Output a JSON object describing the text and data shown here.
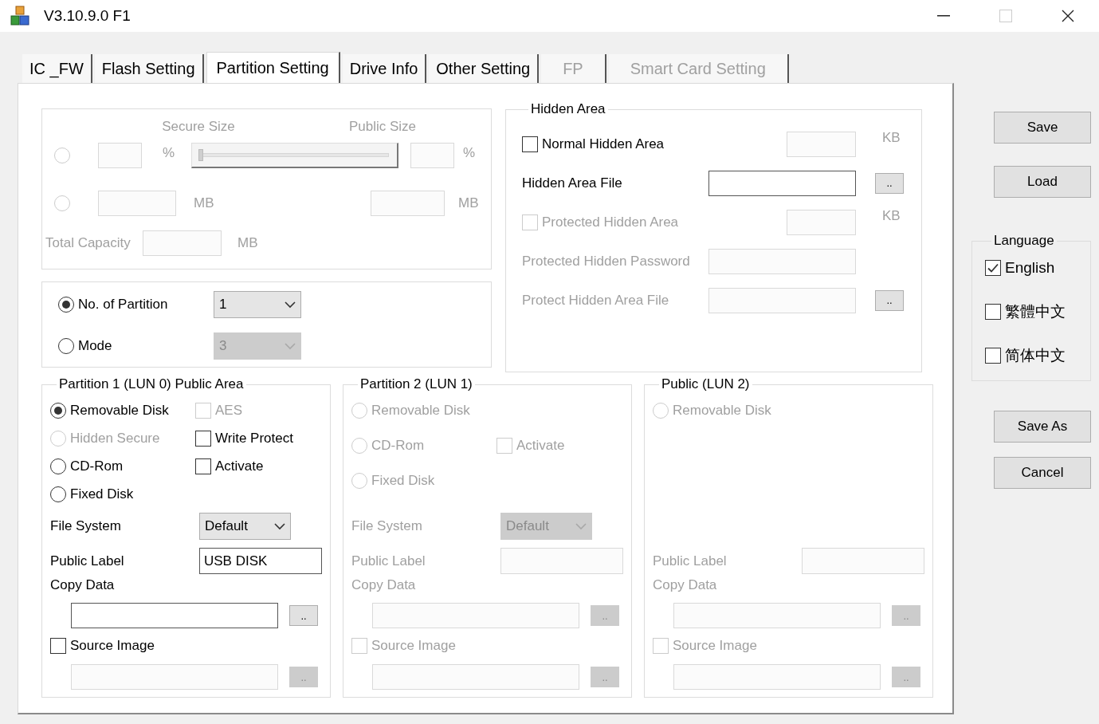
{
  "window": {
    "title": "V3.10.9.0 F1",
    "maximize_disabled": true
  },
  "tabs": [
    {
      "label": "IC _FW",
      "selected": false,
      "disabled": false
    },
    {
      "label": "Flash Setting",
      "selected": false,
      "disabled": false
    },
    {
      "label": "Partition Setting",
      "selected": true,
      "disabled": false
    },
    {
      "label": "Drive Info",
      "selected": false,
      "disabled": false
    },
    {
      "label": "Other Setting",
      "selected": false,
      "disabled": false
    },
    {
      "label": "FP",
      "selected": false,
      "disabled": true
    },
    {
      "label": "Smart Card Setting",
      "selected": false,
      "disabled": true
    }
  ],
  "size_group": {
    "disabled": true,
    "secure_size_label": "Secure Size",
    "public_size_label": "Public Size",
    "percent_row": {
      "selected": false,
      "secure_unit": "%",
      "public_unit": "%",
      "slider": {
        "level": 0
      }
    },
    "mb_row": {
      "selected": false,
      "secure_unit": "MB",
      "public_unit": "MB"
    },
    "total": {
      "label": "Total Capacity",
      "unit": "MB"
    }
  },
  "partition_mode": [
    {
      "label": "No. of Partition",
      "selected": true,
      "value": "1",
      "disabled": false
    },
    {
      "label": "Mode",
      "selected": false,
      "value": "3",
      "disabled": true
    }
  ],
  "hidden_area": {
    "title": "Hidden Area",
    "rows": [
      {
        "kind": "checkbox",
        "label": "Normal Hidden Area",
        "checked": false,
        "disabled": false,
        "field_disabled": true,
        "unit": "KB"
      },
      {
        "kind": "file",
        "label": "Hidden Area File",
        "disabled": false,
        "browse": ".."
      },
      {
        "kind": "checkbox",
        "label": "Protected Hidden Area",
        "checked": false,
        "disabled": true,
        "field_disabled": true,
        "unit": "KB"
      },
      {
        "kind": "field",
        "label": "Protected Hidden Password",
        "disabled": true
      },
      {
        "kind": "file",
        "label": "Protect Hidden Area File",
        "disabled": true,
        "browse": ".."
      }
    ]
  },
  "partitions": [
    {
      "title": "Partition 1 (LUN 0) Public Area",
      "disabled": false,
      "rows": [
        {
          "radio": {
            "label": "Removable Disk",
            "selected": true,
            "disabled": false
          },
          "checkbox": {
            "label": "AES",
            "checked": false,
            "disabled": true
          }
        },
        {
          "radio": {
            "label": "Hidden Secure",
            "selected": false,
            "disabled": true
          },
          "checkbox": {
            "label": "Write Protect",
            "checked": false,
            "disabled": false
          }
        },
        {
          "radio": {
            "label": "CD-Rom",
            "selected": false,
            "disabled": false
          },
          "checkbox": {
            "label": "Activate",
            "checked": false,
            "disabled": false
          }
        },
        {
          "radio": {
            "label": "Fixed Disk",
            "selected": false,
            "disabled": false
          }
        }
      ],
      "file_system": {
        "label": "File System",
        "value": "Default"
      },
      "public_label": {
        "label": "Public Label",
        "value": "USB DISK"
      },
      "copy_data": {
        "label": "Copy Data",
        "browse": ".."
      },
      "source_image": {
        "label": "Source Image",
        "checked": false,
        "browse": ".."
      }
    },
    {
      "title": "Partition 2 (LUN 1)",
      "disabled": true,
      "rows": [
        {
          "radio": {
            "label": "Removable Disk",
            "selected": false,
            "disabled": true
          }
        },
        {
          "radio": {
            "label": "CD-Rom",
            "selected": false,
            "disabled": true
          },
          "checkbox": {
            "label": "Activate",
            "checked": false,
            "disabled": true
          }
        },
        {
          "radio": {
            "label": "Fixed Disk",
            "selected": false,
            "disabled": true
          }
        }
      ],
      "file_system": {
        "label": "File System",
        "value": "Default"
      },
      "public_label": {
        "label": "Public Label"
      },
      "copy_data": {
        "label": "Copy Data",
        "browse": ".."
      },
      "source_image": {
        "label": "Source Image",
        "checked": false,
        "browse": ".."
      }
    },
    {
      "title": "Public (LUN 2)",
      "disabled": true,
      "rows": [
        {
          "radio": {
            "label": "Removable Disk",
            "selected": false,
            "disabled": true
          }
        }
      ],
      "public_label": {
        "label": "Public Label"
      },
      "copy_data": {
        "label": "Copy Data",
        "browse": ".."
      },
      "source_image": {
        "label": "Source Image",
        "checked": false,
        "browse": ".."
      }
    }
  ],
  "side_buttons": [
    {
      "label": "Save"
    },
    {
      "label": "Load"
    }
  ],
  "language": {
    "title": "Language",
    "options": [
      {
        "label": "English",
        "checked": true
      },
      {
        "label": "繁體中文",
        "checked": false
      },
      {
        "label": "简体中文",
        "checked": false
      }
    ]
  },
  "bottom_buttons": [
    {
      "label": "Save As"
    },
    {
      "label": "Cancel"
    }
  ]
}
